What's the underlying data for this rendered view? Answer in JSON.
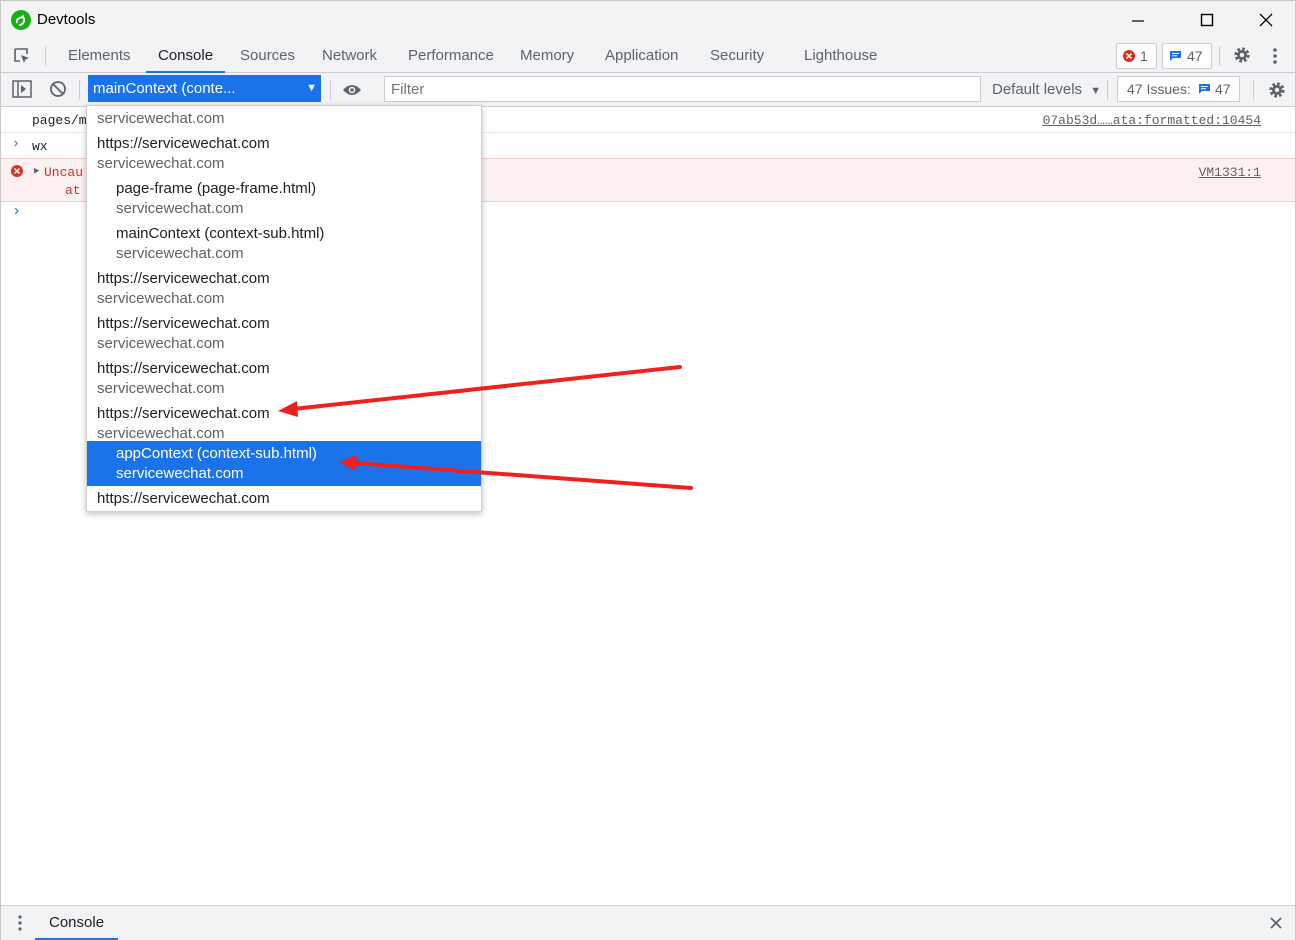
{
  "window": {
    "title": "Devtools"
  },
  "tabs": [
    {
      "label": "Elements",
      "active": false
    },
    {
      "label": "Console",
      "active": true
    },
    {
      "label": "Sources",
      "active": false
    },
    {
      "label": "Network",
      "active": false
    },
    {
      "label": "Performance",
      "active": false
    },
    {
      "label": "Memory",
      "active": false
    },
    {
      "label": "Application",
      "active": false
    },
    {
      "label": "Security",
      "active": false
    },
    {
      "label": "Lighthouse",
      "active": false
    }
  ],
  "badges": {
    "errors": "1",
    "messages": "47"
  },
  "toolbar": {
    "context_label": "mainContext (conte...",
    "filter_placeholder": "Filter",
    "levels_label": "Default levels",
    "issues_label": "47 Issues:",
    "issues_count": "47"
  },
  "console": {
    "line1_text": "pages/m",
    "line1_source": "07ab53d……ata:formatted:10454",
    "line2_text": "wx",
    "error_text": "Uncau",
    "error_text2": "at",
    "error_source": "VM1331:1"
  },
  "dropdown": {
    "items": [
      {
        "title": "",
        "sub": "servicewechat.com",
        "indent": false,
        "selected": false
      },
      {
        "title": "https://servicewechat.com",
        "sub": "servicewechat.com",
        "indent": false,
        "selected": false
      },
      {
        "title": "page-frame (page-frame.html)",
        "sub": "servicewechat.com",
        "indent": true,
        "selected": false
      },
      {
        "title": "mainContext (context-sub.html)",
        "sub": "servicewechat.com",
        "indent": true,
        "selected": false
      },
      {
        "title": "https://servicewechat.com",
        "sub": "servicewechat.com",
        "indent": false,
        "selected": false
      },
      {
        "title": "https://servicewechat.com",
        "sub": "servicewechat.com",
        "indent": false,
        "selected": false
      },
      {
        "title": "https://servicewechat.com",
        "sub": "servicewechat.com",
        "indent": false,
        "selected": false
      },
      {
        "title": "https://servicewechat.com",
        "sub": "servicewechat.com",
        "indent": false,
        "selected": false
      },
      {
        "title": "appContext (context-sub.html)",
        "sub": "servicewechat.com",
        "indent": true,
        "selected": true
      },
      {
        "title": "https://servicewechat.com",
        "sub": "",
        "indent": false,
        "selected": false
      }
    ]
  },
  "drawer": {
    "tab_label": "Console"
  },
  "colors": {
    "accent": "#1a73e8",
    "error": "#d93025",
    "arrow": "#f0201c"
  }
}
